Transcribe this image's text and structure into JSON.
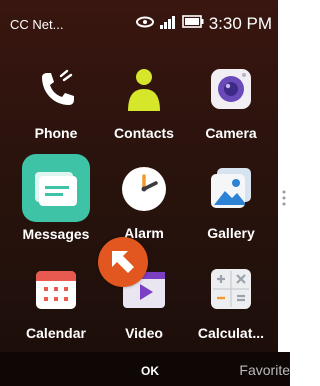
{
  "status": {
    "carrier": "CC Net...",
    "time": "3:30 PM"
  },
  "apps": [
    {
      "label": "Phone",
      "icon": "phone-icon"
    },
    {
      "label": "Contacts",
      "icon": "contacts-icon"
    },
    {
      "label": "Camera",
      "icon": "camera-icon"
    },
    {
      "label": "Messages",
      "icon": "messages-icon",
      "focused": true
    },
    {
      "label": "Alarm",
      "icon": "alarm-icon"
    },
    {
      "label": "Gallery",
      "icon": "gallery-icon"
    },
    {
      "label": "Calendar",
      "icon": "calendar-icon"
    },
    {
      "label": "Video",
      "icon": "video-icon"
    },
    {
      "label": "Calculat...",
      "icon": "calculator-icon"
    }
  ],
  "softkeys": {
    "center": "OK",
    "right": "Favorite"
  },
  "colors": {
    "accent": "#e2571f",
    "messages": "#3fc3a7",
    "background": "#2c130d"
  }
}
